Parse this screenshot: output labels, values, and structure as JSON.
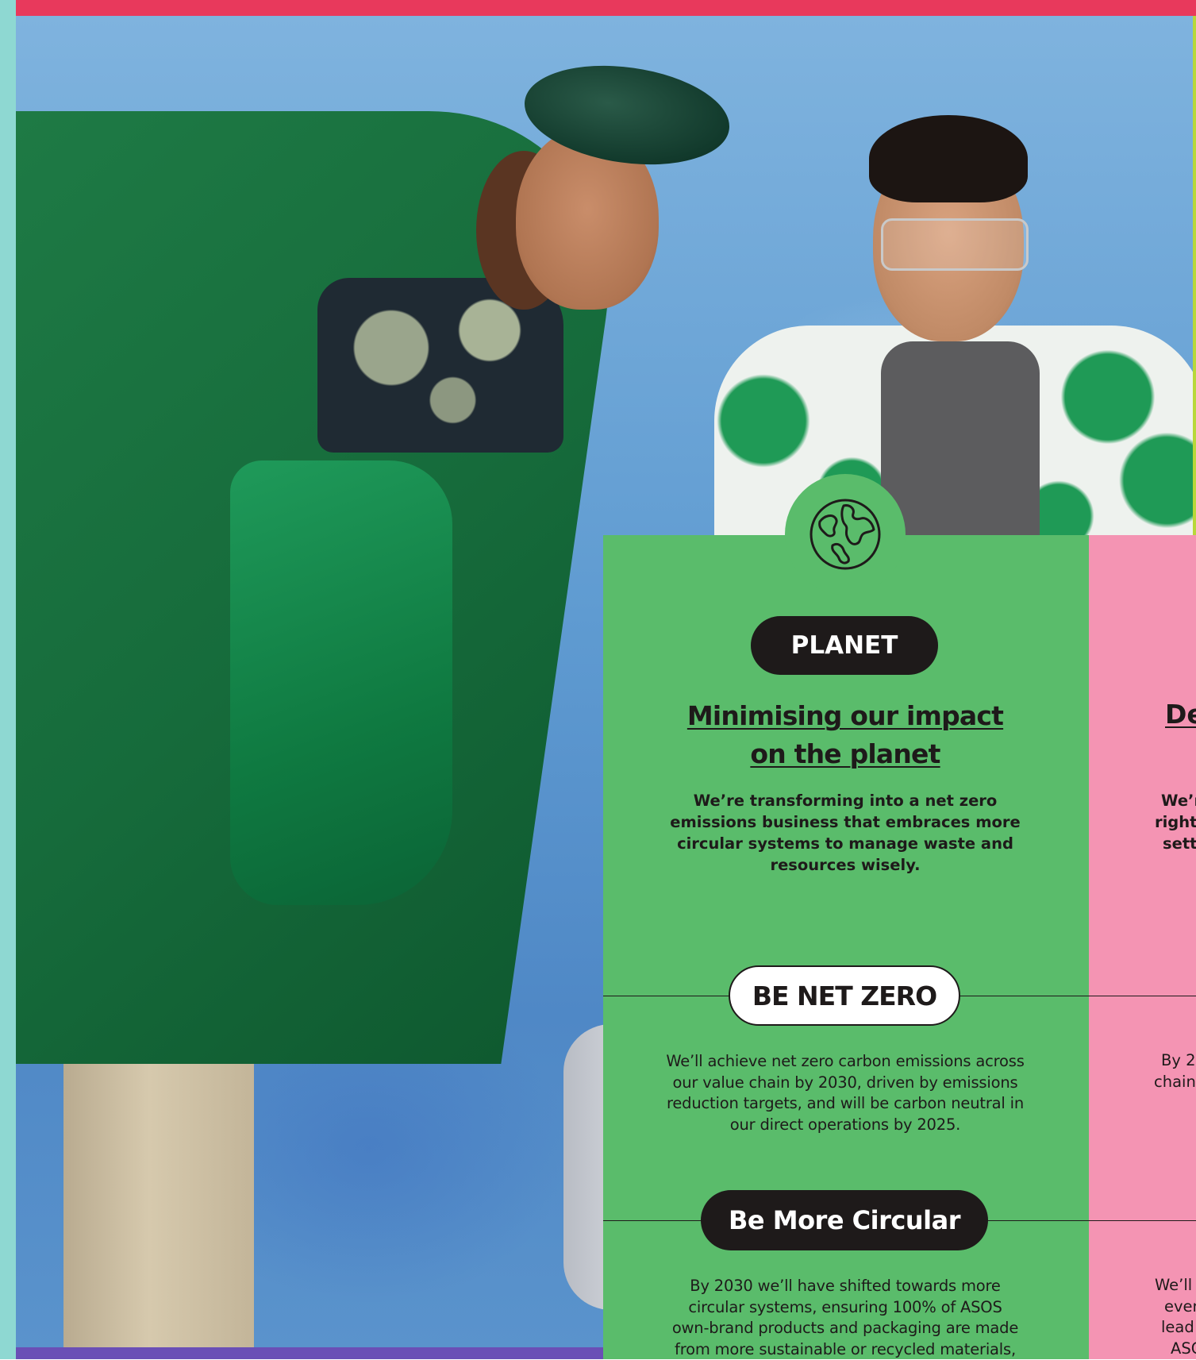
{
  "colors": {
    "top_bar": "#e8395c",
    "left_bar": "#8ed8d2",
    "bottom_bar": "#6a4fb6",
    "right_bar": "#b8d83a",
    "planet_panel": "#5abc6b",
    "pink_panel": "#f494b3",
    "ink": "#1e1a1a"
  },
  "icons": {
    "planet": "earth-globe-icon"
  },
  "planet": {
    "tag": "PLANET",
    "heading_lines": [
      "Minimising our impact",
      "on the planet"
    ],
    "lede_lines": [
      "We’re transforming into a net zero",
      "emissions business that embraces more",
      "circular systems to manage waste and",
      "resources wisely."
    ],
    "net_zero": {
      "tag": "BE NET ZERO",
      "body_lines": [
        "We’ll achieve net zero carbon emissions across",
        "our value chain by 2030, driven by emissions",
        "reduction targets, and will be carbon neutral in",
        "our direct operations by 2025."
      ]
    },
    "circular": {
      "tag": "Be More Circular",
      "body_lines": [
        "By 2030 we’ll have shifted towards more",
        "circular systems, ensuring 100% of ASOS",
        "own-brand products and packaging are made",
        "from more sustainable or recycled materials,"
      ]
    }
  },
  "pink_panel": {
    "heading": "De",
    "lede_lines": [
      "We’r",
      "right",
      "sett"
    ],
    "body_a_lines": [
      "By 20",
      "chain"
    ],
    "body_b_lines": [
      "We’ll",
      "ever",
      "lead",
      "ASC"
    ]
  }
}
